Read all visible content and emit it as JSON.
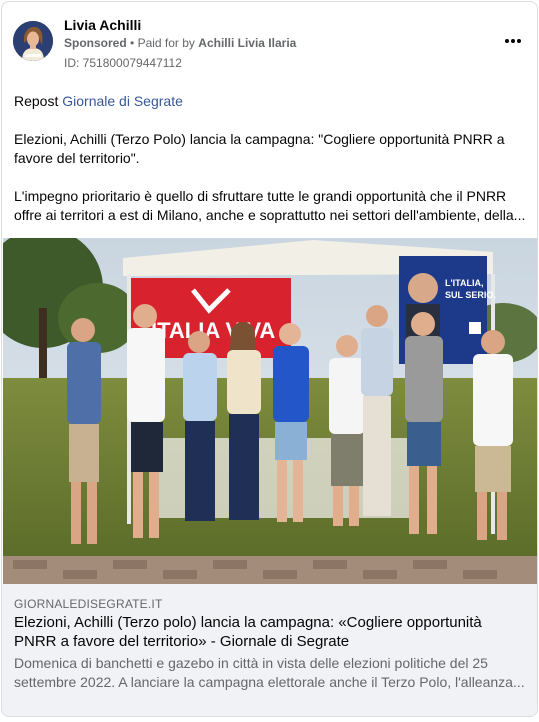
{
  "post": {
    "author": "Livia Achilli",
    "sponsored_label": "Sponsored",
    "separator": "•",
    "paid_for_prefix": "Paid for by",
    "paid_for_name": "Achilli Livia Ilaria",
    "ad_id": "ID: 751800079447112",
    "more_icon": "more-horizontal-icon"
  },
  "body": {
    "repost_prefix": "Repost",
    "repost_source": "Giornale di Segrate",
    "paragraph1": "Elezioni, Achilli (Terzo Polo) lancia la campagna: \"Cogliere opportunità PNRR a favore del territorio\".",
    "paragraph2_line1": "L'impegno prioritario è quello di sfruttare tutte le grandi opportunità che il PNRR",
    "paragraph2_line2": "offre ai territori a est di Milano, anche e soprattutto nei settori dell'ambiente, della..."
  },
  "photo": {
    "banner_text": "ITALIA VIVA",
    "poster_line1": "L'ITALIA,",
    "poster_line2": "SUL SERIO."
  },
  "link_preview": {
    "domain": "GIORNALEDISEGRATE.IT",
    "title": "Elezioni, Achilli (Terzo polo) lancia la campagna: «Cogliere opportunità PNRR a favore del territorio» - Giornale di Segrate",
    "description_line1": "Domenica di banchetti e gazebo in città in vista delle elezioni politiche del 25",
    "description_line2": "settembre 2022. A lanciare la campagna elettorale anche il Terzo Polo, l'alleanza..."
  },
  "colors": {
    "link": "#385898",
    "secondary_text": "#65676b",
    "footer_bg": "#f0f2f5",
    "banner_red": "#d8232f",
    "poster_blue": "#1d3a8a"
  }
}
